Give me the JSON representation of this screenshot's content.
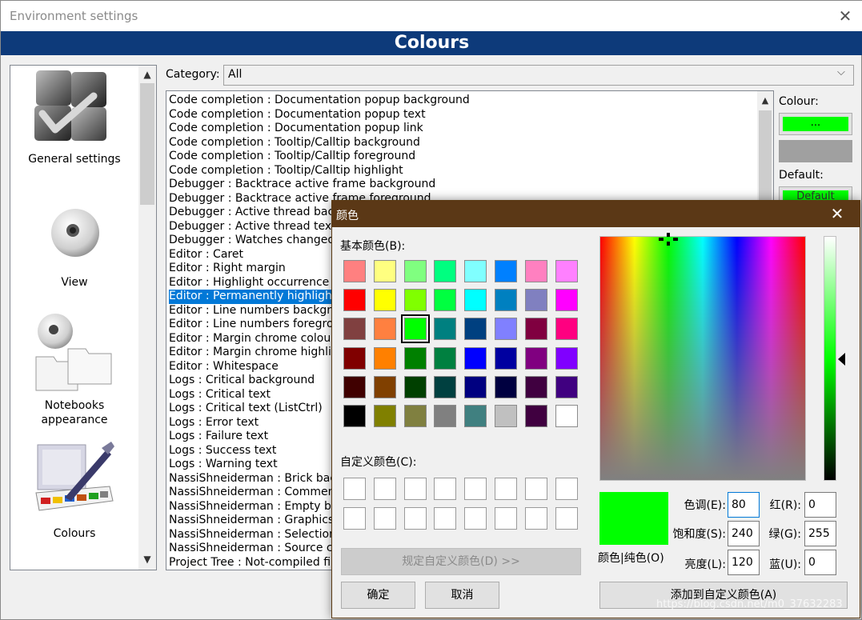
{
  "window": {
    "title": "Environment settings",
    "close_glyph": "✕"
  },
  "banner": {
    "title": "Colours"
  },
  "sidebar": {
    "items": [
      {
        "label": "General settings",
        "icon": "general-settings-icon"
      },
      {
        "label": "View",
        "icon": "eye-icon"
      },
      {
        "label": "Notebooks appearance",
        "icon": "notebooks-icon"
      },
      {
        "label": "Colours",
        "icon": "palette-icon"
      }
    ],
    "scroll_up": "▲",
    "scroll_down": "▼"
  },
  "category": {
    "label": "Category:",
    "value": "All",
    "chevron": "⌵"
  },
  "list": {
    "items": [
      "Code completion : Documentation popup background",
      "Code completion : Documentation popup text",
      "Code completion : Documentation popup link",
      "Code completion : Tooltip/Calltip background",
      "Code completion : Tooltip/Calltip foreground",
      "Code completion : Tooltip/Calltip highlight",
      "Debugger : Backtrace active frame background",
      "Debugger : Backtrace active frame foreground",
      "Debugger : Active thread background",
      "Debugger : Active thread text",
      "Debugger : Watches changed value",
      "Editor : Caret",
      "Editor : Right margin",
      "Editor : Highlight occurrence",
      "Editor : Permanently highlighted occurrences",
      "Editor : Line numbers background",
      "Editor : Line numbers foreground",
      "Editor : Margin chrome colour",
      "Editor : Margin chrome highlight",
      "Editor : Whitespace",
      "Logs : Critical background",
      "Logs : Critical text",
      "Logs : Critical text (ListCtrl)",
      "Logs : Error text",
      "Logs : Failure text",
      "Logs : Success text",
      "Logs : Warning text",
      "NassiShneiderman : Brick background",
      "NassiShneiderman : Comment",
      "NassiShneiderman : Empty brick",
      "NassiShneiderman : Graphics colour",
      "NassiShneiderman : Selection",
      "NassiShneiderman : Source code",
      "Project Tree : Not-compiled file"
    ],
    "selected_index": 14,
    "scroll_up": "▲"
  },
  "colour_panel": {
    "colour_label": "Colour:",
    "colour_button": "...",
    "current_colour": "#00ff00",
    "default_label": "Default:",
    "default_button": "Default"
  },
  "dialog": {
    "title": "颜色",
    "close_glyph": "✕",
    "basic_colors_label": "基本颜色(B):",
    "basic_colors": [
      "#ff8080",
      "#ffff80",
      "#80ff80",
      "#00ff80",
      "#80ffff",
      "#0080ff",
      "#ff80c0",
      "#ff80ff",
      "#ff0000",
      "#ffff00",
      "#80ff00",
      "#00ff40",
      "#00ffff",
      "#0080c0",
      "#8080c0",
      "#ff00ff",
      "#804040",
      "#ff8040",
      "#00ff00",
      "#008080",
      "#004080",
      "#8080ff",
      "#800040",
      "#ff0080",
      "#800000",
      "#ff8000",
      "#008000",
      "#008040",
      "#0000ff",
      "#0000a0",
      "#800080",
      "#8000ff",
      "#400000",
      "#804000",
      "#004000",
      "#004040",
      "#000080",
      "#000040",
      "#400040",
      "#400080",
      "#000000",
      "#808000",
      "#808040",
      "#808080",
      "#408080",
      "#c0c0c0",
      "#400040",
      "#ffffff"
    ],
    "selected_basic_index": 18,
    "custom_colors_label": "自定义颜色(C):",
    "define_custom_button": "规定自定义颜色(D) >>",
    "ok_button": "确定",
    "cancel_button": "取消",
    "preview_label": "颜色|纯色(O)",
    "preview_color": "#00ff00",
    "fields": {
      "hue_label": "色调(E):",
      "hue": "80",
      "sat_label": "饱和度(S):",
      "sat": "240",
      "lum_label": "亮度(L):",
      "lum": "120",
      "red_label": "红(R):",
      "red": "0",
      "green_label": "绿(G):",
      "green": "255",
      "blue_label": "蓝(U):",
      "blue": "0"
    },
    "add_custom_button": "添加到自定义颜色(A)"
  },
  "watermark": "https://blog.csdn.net/m0_37632283"
}
